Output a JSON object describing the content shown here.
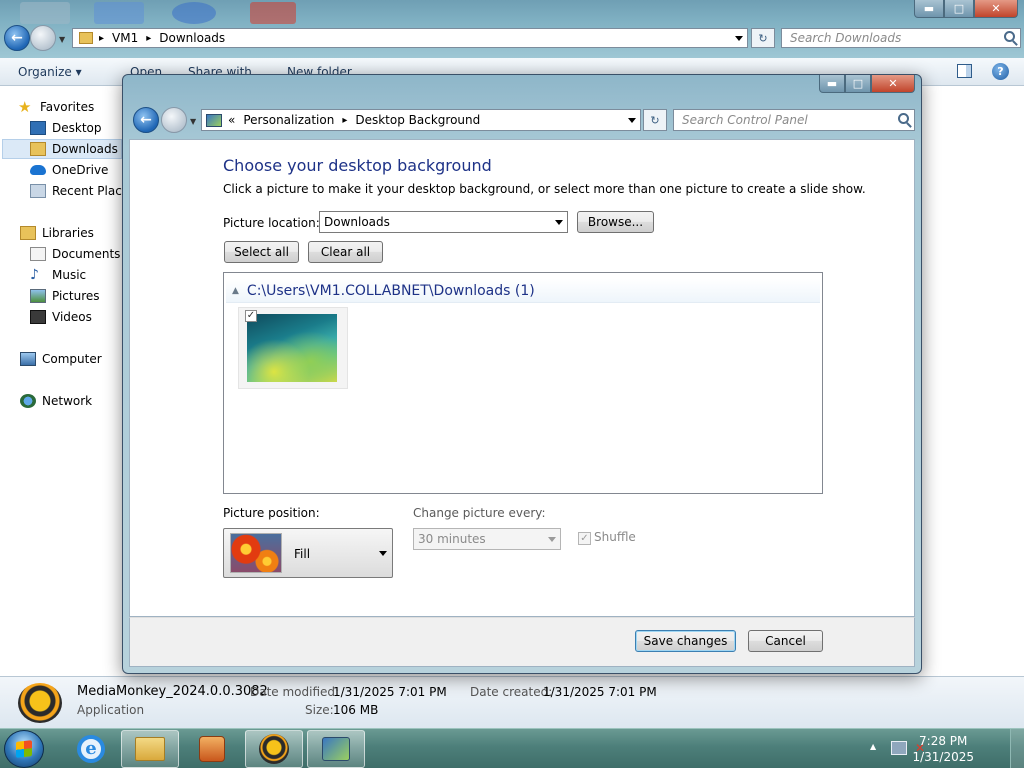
{
  "explorer": {
    "address": {
      "chevron": "▸",
      "parts": [
        "VM1",
        "Downloads"
      ]
    },
    "search_placeholder": "Search Downloads",
    "toolbar": {
      "organize": "Organize",
      "open": "Open",
      "share_with": "Share with",
      "new_folder": "New folder"
    },
    "nav": {
      "favorites": {
        "header": "Favorites",
        "items": [
          "Desktop",
          "Downloads",
          "OneDrive",
          "Recent Places"
        ]
      },
      "libraries": {
        "header": "Libraries",
        "items": [
          "Documents",
          "Music",
          "Pictures",
          "Videos"
        ]
      },
      "computer": "Computer",
      "network": "Network"
    },
    "details": {
      "name": "MediaMonkey_2024.0.0.3082",
      "type": "Application",
      "date_modified_label": "Date modified:",
      "date_modified": "1/31/2025 7:01 PM",
      "date_created_label": "Date created:",
      "date_created": "1/31/2025 7:01 PM",
      "size_label": "Size:",
      "size": "106 MB"
    }
  },
  "control_panel": {
    "address": {
      "prefix": "«",
      "parts": [
        "Personalization",
        "Desktop Background"
      ],
      "chevron": "▸"
    },
    "search_placeholder": "Search Control Panel",
    "title": "Choose your desktop background",
    "instructions": "Click a picture to make it your desktop background, or select more than one picture to create a slide show.",
    "picture_location_label": "Picture location:",
    "picture_location_value": "Downloads",
    "browse_label": "Browse...",
    "select_all_label": "Select all",
    "clear_all_label": "Clear all",
    "group_header": "C:\\Users\\VM1.COLLABNET\\Downloads (1)",
    "group_collapse_icon": "▲",
    "thumbnail_checked": "✓",
    "picture_position_label": "Picture position:",
    "picture_position_value": "Fill",
    "change_picture_label": "Change picture every:",
    "change_picture_value": "30 minutes",
    "shuffle_label": "Shuffle",
    "shuffle_checked": "✓",
    "save_label": "Save changes",
    "cancel_label": "Cancel"
  },
  "caption_buttons": {
    "minimize": "▬",
    "maximize": "□",
    "close": "✕"
  },
  "taskbar": {
    "time": "7:28 PM",
    "date": "1/31/2025",
    "tray_expand": "▲"
  },
  "colors": {
    "heading": "#1e3287",
    "taskbar": "#4d7f7a",
    "window_frame": "#a8c9d6"
  }
}
